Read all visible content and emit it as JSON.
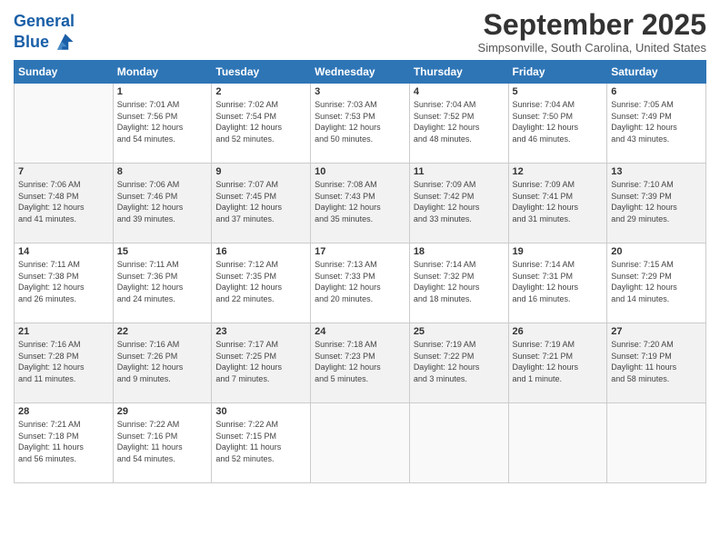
{
  "header": {
    "logo_line1": "General",
    "logo_line2": "Blue",
    "month": "September 2025",
    "location": "Simpsonville, South Carolina, United States"
  },
  "weekdays": [
    "Sunday",
    "Monday",
    "Tuesday",
    "Wednesday",
    "Thursday",
    "Friday",
    "Saturday"
  ],
  "weeks": [
    [
      {
        "day": "",
        "info": ""
      },
      {
        "day": "1",
        "info": "Sunrise: 7:01 AM\nSunset: 7:56 PM\nDaylight: 12 hours\nand 54 minutes."
      },
      {
        "day": "2",
        "info": "Sunrise: 7:02 AM\nSunset: 7:54 PM\nDaylight: 12 hours\nand 52 minutes."
      },
      {
        "day": "3",
        "info": "Sunrise: 7:03 AM\nSunset: 7:53 PM\nDaylight: 12 hours\nand 50 minutes."
      },
      {
        "day": "4",
        "info": "Sunrise: 7:04 AM\nSunset: 7:52 PM\nDaylight: 12 hours\nand 48 minutes."
      },
      {
        "day": "5",
        "info": "Sunrise: 7:04 AM\nSunset: 7:50 PM\nDaylight: 12 hours\nand 46 minutes."
      },
      {
        "day": "6",
        "info": "Sunrise: 7:05 AM\nSunset: 7:49 PM\nDaylight: 12 hours\nand 43 minutes."
      }
    ],
    [
      {
        "day": "7",
        "info": "Sunrise: 7:06 AM\nSunset: 7:48 PM\nDaylight: 12 hours\nand 41 minutes."
      },
      {
        "day": "8",
        "info": "Sunrise: 7:06 AM\nSunset: 7:46 PM\nDaylight: 12 hours\nand 39 minutes."
      },
      {
        "day": "9",
        "info": "Sunrise: 7:07 AM\nSunset: 7:45 PM\nDaylight: 12 hours\nand 37 minutes."
      },
      {
        "day": "10",
        "info": "Sunrise: 7:08 AM\nSunset: 7:43 PM\nDaylight: 12 hours\nand 35 minutes."
      },
      {
        "day": "11",
        "info": "Sunrise: 7:09 AM\nSunset: 7:42 PM\nDaylight: 12 hours\nand 33 minutes."
      },
      {
        "day": "12",
        "info": "Sunrise: 7:09 AM\nSunset: 7:41 PM\nDaylight: 12 hours\nand 31 minutes."
      },
      {
        "day": "13",
        "info": "Sunrise: 7:10 AM\nSunset: 7:39 PM\nDaylight: 12 hours\nand 29 minutes."
      }
    ],
    [
      {
        "day": "14",
        "info": "Sunrise: 7:11 AM\nSunset: 7:38 PM\nDaylight: 12 hours\nand 26 minutes."
      },
      {
        "day": "15",
        "info": "Sunrise: 7:11 AM\nSunset: 7:36 PM\nDaylight: 12 hours\nand 24 minutes."
      },
      {
        "day": "16",
        "info": "Sunrise: 7:12 AM\nSunset: 7:35 PM\nDaylight: 12 hours\nand 22 minutes."
      },
      {
        "day": "17",
        "info": "Sunrise: 7:13 AM\nSunset: 7:33 PM\nDaylight: 12 hours\nand 20 minutes."
      },
      {
        "day": "18",
        "info": "Sunrise: 7:14 AM\nSunset: 7:32 PM\nDaylight: 12 hours\nand 18 minutes."
      },
      {
        "day": "19",
        "info": "Sunrise: 7:14 AM\nSunset: 7:31 PM\nDaylight: 12 hours\nand 16 minutes."
      },
      {
        "day": "20",
        "info": "Sunrise: 7:15 AM\nSunset: 7:29 PM\nDaylight: 12 hours\nand 14 minutes."
      }
    ],
    [
      {
        "day": "21",
        "info": "Sunrise: 7:16 AM\nSunset: 7:28 PM\nDaylight: 12 hours\nand 11 minutes."
      },
      {
        "day": "22",
        "info": "Sunrise: 7:16 AM\nSunset: 7:26 PM\nDaylight: 12 hours\nand 9 minutes."
      },
      {
        "day": "23",
        "info": "Sunrise: 7:17 AM\nSunset: 7:25 PM\nDaylight: 12 hours\nand 7 minutes."
      },
      {
        "day": "24",
        "info": "Sunrise: 7:18 AM\nSunset: 7:23 PM\nDaylight: 12 hours\nand 5 minutes."
      },
      {
        "day": "25",
        "info": "Sunrise: 7:19 AM\nSunset: 7:22 PM\nDaylight: 12 hours\nand 3 minutes."
      },
      {
        "day": "26",
        "info": "Sunrise: 7:19 AM\nSunset: 7:21 PM\nDaylight: 12 hours\nand 1 minute."
      },
      {
        "day": "27",
        "info": "Sunrise: 7:20 AM\nSunset: 7:19 PM\nDaylight: 11 hours\nand 58 minutes."
      }
    ],
    [
      {
        "day": "28",
        "info": "Sunrise: 7:21 AM\nSunset: 7:18 PM\nDaylight: 11 hours\nand 56 minutes."
      },
      {
        "day": "29",
        "info": "Sunrise: 7:22 AM\nSunset: 7:16 PM\nDaylight: 11 hours\nand 54 minutes."
      },
      {
        "day": "30",
        "info": "Sunrise: 7:22 AM\nSunset: 7:15 PM\nDaylight: 11 hours\nand 52 minutes."
      },
      {
        "day": "",
        "info": ""
      },
      {
        "day": "",
        "info": ""
      },
      {
        "day": "",
        "info": ""
      },
      {
        "day": "",
        "info": ""
      }
    ]
  ]
}
